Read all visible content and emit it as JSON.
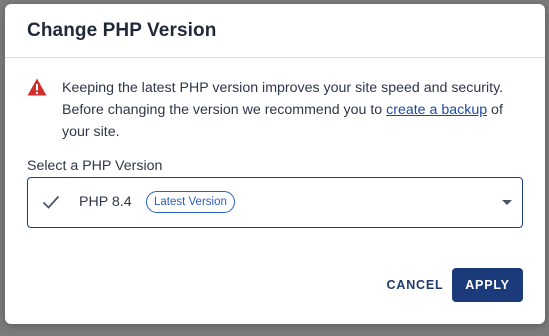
{
  "dialog": {
    "title": "Change PHP Version",
    "warning": {
      "icon": "warning-icon",
      "text_before": "Keeping the latest PHP version improves your site speed and security. Before changing the version we recommend you to ",
      "link_text": "create a backup",
      "text_after": " of your site."
    },
    "select": {
      "label": "Select a PHP Version",
      "selected_value": "PHP 8.4",
      "badge": "Latest Version",
      "check_icon": "check-icon",
      "caret_icon": "chevron-down-icon"
    },
    "actions": {
      "cancel_label": "CANCEL",
      "apply_label": "APPLY"
    }
  },
  "colors": {
    "accent": "#1b3a7a",
    "link": "#1e4aa0",
    "warning": "#d32f2f",
    "badge": "#2b5fc7"
  }
}
